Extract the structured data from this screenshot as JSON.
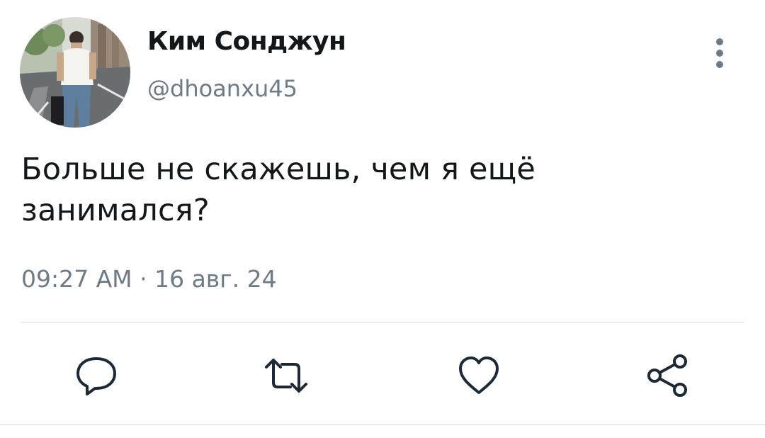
{
  "user": {
    "display_name": "Ким Сонджун",
    "handle": "@dhoanxu45",
    "avatar_icon": "user-avatar-photo"
  },
  "tweet": {
    "text": "Больше не скажешь, чем я ещё занимался?",
    "timestamp": "09:27 AM · 16 авг. 24"
  },
  "menu": {
    "icon": "vertical-more-icon"
  },
  "actions": [
    {
      "name": "reply",
      "icon": "comment-bubble-icon"
    },
    {
      "name": "retweet",
      "icon": "retweet-icon"
    },
    {
      "name": "like",
      "icon": "heart-icon"
    },
    {
      "name": "share",
      "icon": "share-icon"
    }
  ],
  "colors": {
    "text": "#14171a",
    "secondary": "#6e7a85",
    "divider": "#e6ecf0",
    "action_icon": "#1d2a36"
  }
}
